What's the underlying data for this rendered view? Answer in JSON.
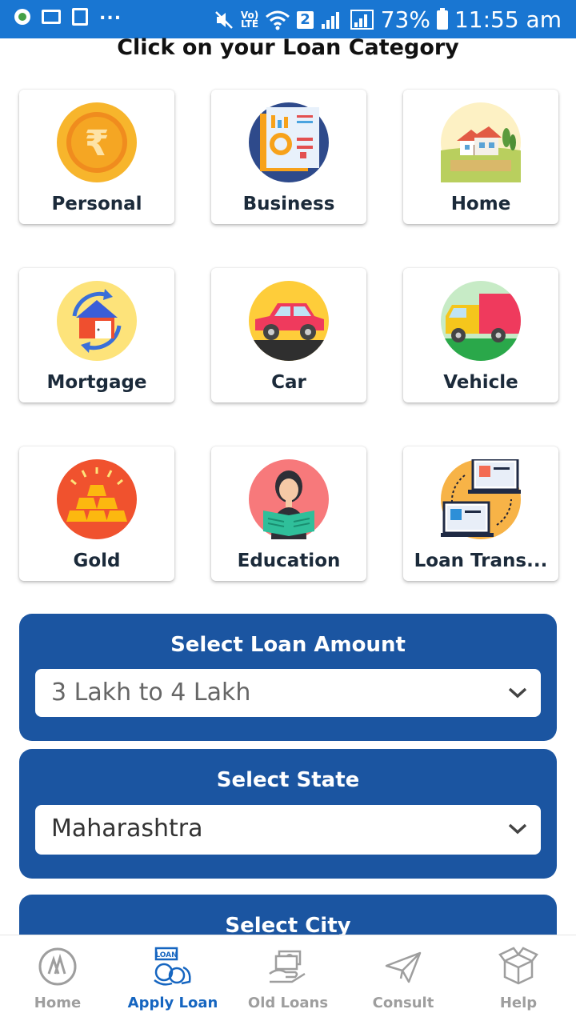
{
  "status_bar": {
    "more": "...",
    "volte": "Vo)",
    "lte": "LTE",
    "sim": "2",
    "battery": "73%",
    "time": "11:55 am"
  },
  "page": {
    "title": "Click on your Loan Category"
  },
  "categories": [
    {
      "label": "Personal",
      "icon": "rupee-coin-icon"
    },
    {
      "label": "Business",
      "icon": "business-report-icon"
    },
    {
      "label": "Home",
      "icon": "house-icon"
    },
    {
      "label": "Mortgage",
      "icon": "mortgage-house-icon"
    },
    {
      "label": "Car",
      "icon": "car-icon"
    },
    {
      "label": "Vehicle",
      "icon": "truck-icon"
    },
    {
      "label": "Gold",
      "icon": "gold-bars-icon"
    },
    {
      "label": "Education",
      "icon": "student-reading-icon"
    },
    {
      "label": "Loan Trans...",
      "icon": "loan-transfer-icon"
    }
  ],
  "loan_amount": {
    "title": "Select Loan Amount",
    "value": "3 Lakh to 4 Lakh"
  },
  "state": {
    "title": "Select State",
    "value": "Maharashtra"
  },
  "city": {
    "title": "Select City"
  },
  "bottom_nav": [
    {
      "label": "Home",
      "icon": "home-logo-icon",
      "active": false
    },
    {
      "label": "Apply Loan",
      "icon": "apply-loan-icon",
      "active": true
    },
    {
      "label": "Old Loans",
      "icon": "old-loans-icon",
      "active": false
    },
    {
      "label": "Consult",
      "icon": "paper-plane-icon",
      "active": false
    },
    {
      "label": "Help",
      "icon": "help-box-icon",
      "active": false
    }
  ],
  "colors": {
    "status_bar": "#1976d2",
    "panel": "#1b55a1",
    "active_nav": "#1565c0",
    "inactive_nav": "#9e9e9e"
  }
}
